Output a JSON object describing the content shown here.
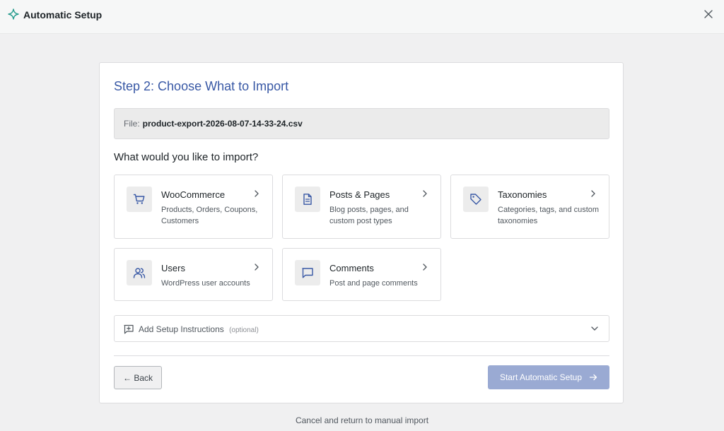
{
  "app": {
    "title": "Automatic Setup",
    "brand_icon": "sparkle-icon",
    "close_icon": "close-icon"
  },
  "step": {
    "title": "Step 2: Choose What to Import"
  },
  "file": {
    "label": "File:",
    "name": "product-export-2026-08-07-14-33-24.csv"
  },
  "question": "What would you like to import?",
  "options": [
    {
      "title": "WooCommerce",
      "description": "Products, Orders, Coupons, Customers",
      "icon": "cart-icon"
    },
    {
      "title": "Posts & Pages",
      "description": "Blog posts, pages, and custom post types",
      "icon": "document-icon"
    },
    {
      "title": "Taxonomies",
      "description": "Categories, tags, and custom taxonomies",
      "icon": "tag-icon"
    },
    {
      "title": "Users",
      "description": "WordPress user accounts",
      "icon": "users-icon"
    },
    {
      "title": "Comments",
      "description": "Post and page comments",
      "icon": "comment-icon"
    }
  ],
  "instructions": {
    "label": "Add Setup Instructions",
    "optional": "(optional)"
  },
  "buttons": {
    "back": "← Back",
    "start": "Start Automatic Setup"
  },
  "cancel_link": "Cancel and return to manual import",
  "colors": {
    "accent": "#3858a5",
    "primary_disabled": "#9aaad3",
    "background": "#f0f0f1"
  }
}
